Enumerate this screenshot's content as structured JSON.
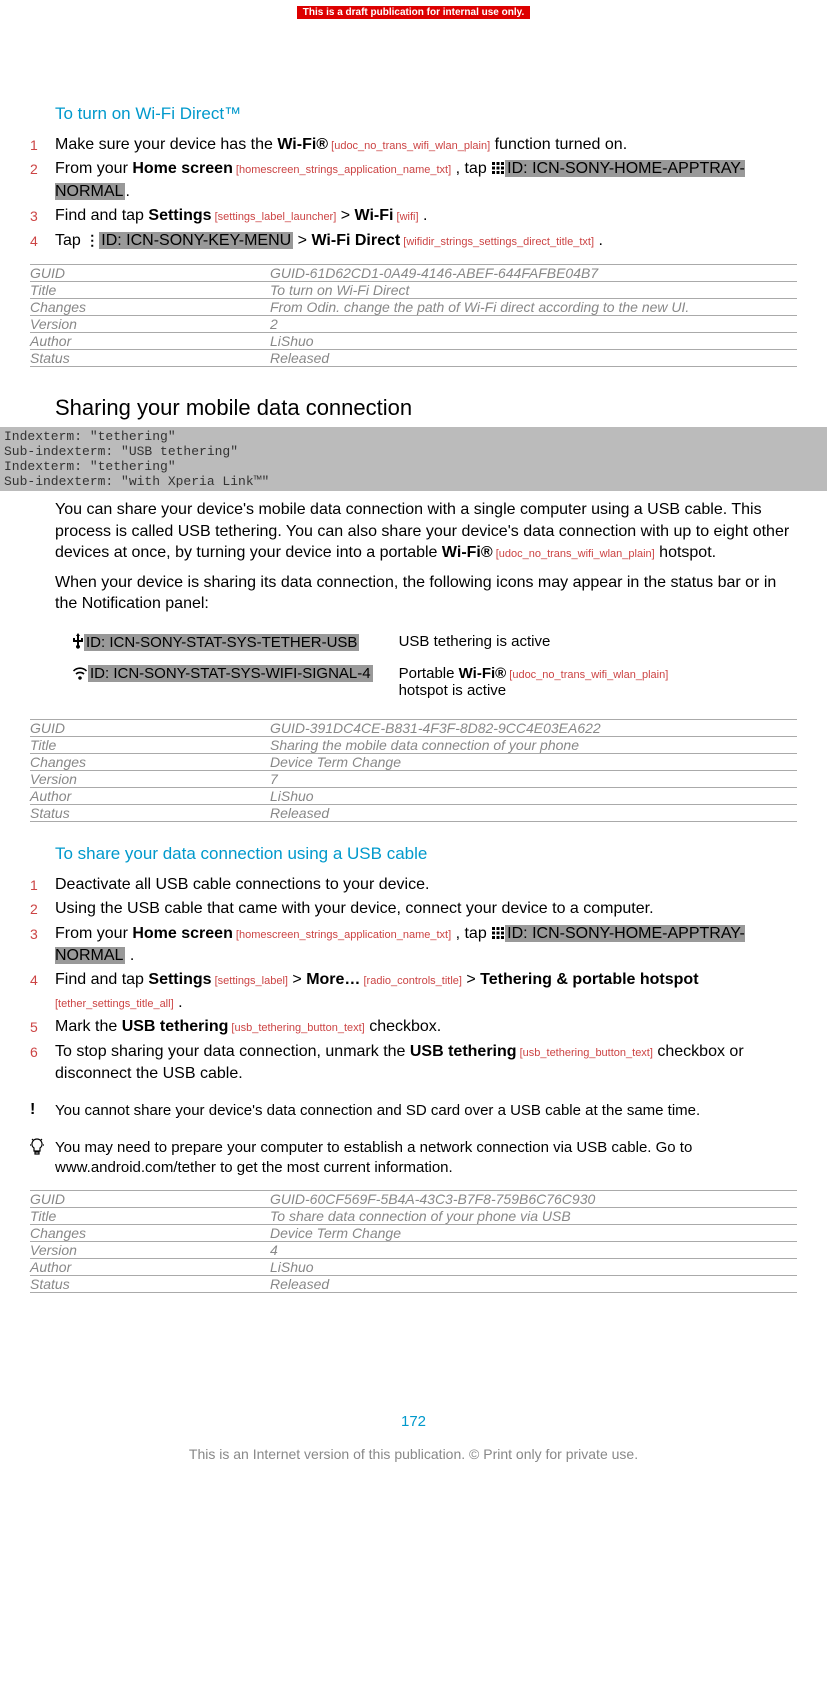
{
  "banner": "This is a draft publication for internal use only.",
  "section1": {
    "title": "To turn on Wi-Fi Direct™",
    "steps": {
      "s1_a": "Make sure your device has the ",
      "s1_wifi": "Wi-Fi®",
      "s1_ref": " [udoc_no_trans_wifi_wlan_plain]",
      "s1_b": " function turned on.",
      "s2_a": "From your ",
      "s2_home": "Home screen",
      "s2_ref1": " [homescreen_strings_application_name_txt]",
      "s2_b": " , tap ",
      "s2_icon": "ID: ICN-SONY-HOME-APPTRAY-NORMAL",
      "s2_c": ".",
      "s3_a": "Find and tap ",
      "s3_settings": "Settings",
      "s3_ref1": " [settings_label_launcher]",
      "s3_gt": " > ",
      "s3_wifi": "Wi-Fi",
      "s3_ref2": " [wifi]",
      "s3_b": " .",
      "s4_a": "Tap ",
      "s4_icon": "ID: ICN-SONY-KEY-MENU",
      "s4_gt": " > ",
      "s4_direct": "Wi-Fi Direct",
      "s4_ref": " [wifidir_strings_settings_direct_title_txt]",
      "s4_b": " ."
    }
  },
  "meta1": {
    "guid_k": "GUID",
    "guid_v": "GUID-61D62CD1-0A49-4146-ABEF-644FAFBE04B7",
    "title_k": "Title",
    "title_v": "To turn on Wi-Fi Direct",
    "changes_k": "Changes",
    "changes_v": "From Odin. change the path of Wi-Fi direct according to the new UI.",
    "version_k": "Version",
    "version_v": "2",
    "author_k": "Author",
    "author_v": "LiShuo",
    "status_k": "Status",
    "status_v": "Released"
  },
  "section2": {
    "title": "Sharing your mobile data connection",
    "indexterms": "Indexterm: \"tethering\"\nSub-indexterm: \"USB tethering\"\nIndexterm: \"tethering\"\nSub-indexterm: \"with Xperia Link™\"",
    "para1_a": "You can share your device's mobile data connection with a single computer using a USB cable. This process is called USB tethering. You can also share your device's data connection with up to eight other devices at once, by turning your device into a portable ",
    "para1_wifi": "Wi-Fi®",
    "para1_ref": " [udoc_no_trans_wifi_wlan_plain]",
    "para1_b": " hotspot.",
    "para2": "When your device is sharing its data connection, the following icons may appear in the status bar or in the Notification panel:",
    "icons": {
      "i1_id": "ID: ICN-SONY-STAT-SYS-TETHER-USB",
      "i1_desc": "USB tethering is active",
      "i2_id": "ID: ICN-SONY-STAT-SYS-WIFI-SIGNAL-4",
      "i2_a": "Portable ",
      "i2_wifi": "Wi-Fi®",
      "i2_ref": " [udoc_no_trans_wifi_wlan_plain]",
      "i2_b": " hotspot is active"
    }
  },
  "meta2": {
    "guid_k": "GUID",
    "guid_v": "GUID-391DC4CE-B831-4F3F-8D82-9CC4E03EA622",
    "title_k": "Title",
    "title_v": "Sharing the mobile data connection of your phone",
    "changes_k": "Changes",
    "changes_v": "Device Term Change",
    "version_k": "Version",
    "version_v": "7",
    "author_k": "Author",
    "author_v": "LiShuo",
    "status_k": "Status",
    "status_v": "Released"
  },
  "section3": {
    "title": "To share your data connection using a USB cable",
    "steps": {
      "s1": "Deactivate all USB cable connections to your device.",
      "s2": "Using the USB cable that came with your device, connect your device to a computer.",
      "s3_a": "From your ",
      "s3_home": "Home screen",
      "s3_ref1": " [homescreen_strings_application_name_txt]",
      "s3_b": " , tap ",
      "s3_icon": "ID: ICN-SONY-HOME-APPTRAY-NORMAL",
      "s3_c": " .",
      "s4_a": "Find and tap ",
      "s4_settings": "Settings",
      "s4_ref1": " [settings_label]",
      "s4_gt1": " > ",
      "s4_more": "More…",
      "s4_ref2": " [radio_controls_title]",
      "s4_gt2": " > ",
      "s4_teth": "Tethering & portable hotspot",
      "s4_ref3": " [tether_settings_title_all]",
      "s4_b": " .",
      "s5_a": "Mark the ",
      "s5_usb": "USB tethering",
      "s5_ref": " [usb_tethering_button_text]",
      "s5_b": " checkbox.",
      "s6_a": "To stop sharing your data connection, unmark the ",
      "s6_usb": "USB tethering",
      "s6_ref": " [usb_tethering_button_text]",
      "s6_b": " checkbox or disconnect the USB cable."
    },
    "note1": "You cannot share your device's data connection and SD card over a USB cable at the same time.",
    "note2": "You may need to prepare your computer to establish a network connection via USB cable. Go to www.android.com/tether to get the most current information."
  },
  "meta3": {
    "guid_k": "GUID",
    "guid_v": "GUID-60CF569F-5B4A-43C3-B7F8-759B6C76C930",
    "title_k": "Title",
    "title_v": "To share data connection of your phone via USB",
    "changes_k": "Changes",
    "changes_v": "Device Term Change",
    "version_k": "Version",
    "version_v": "4",
    "author_k": "Author",
    "author_v": "LiShuo",
    "status_k": "Status",
    "status_v": "Released"
  },
  "page_number": "172",
  "footer": "This is an Internet version of this publication. © Print only for private use."
}
